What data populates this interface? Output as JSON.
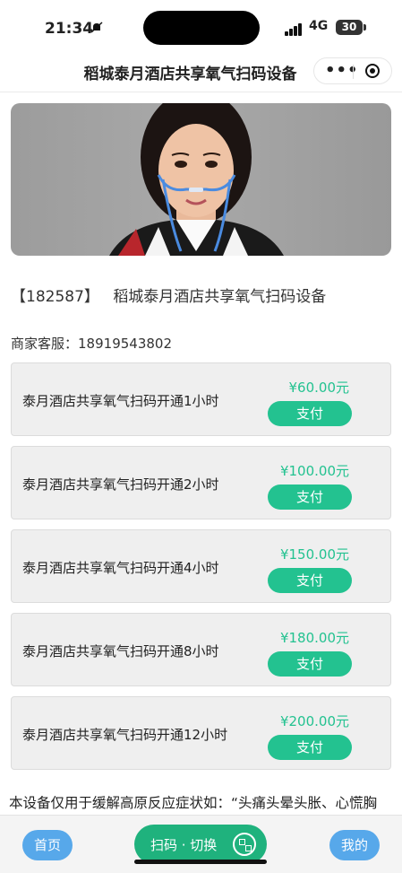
{
  "status_bar": {
    "time": "21:34",
    "network": "4G",
    "battery": "30"
  },
  "nav": {
    "title": "稻城泰月酒店共享氧气扫码设备"
  },
  "device": {
    "code": "【182587】",
    "name": "稻城泰月酒店共享氧气扫码设备"
  },
  "service": {
    "label": "商家客服：",
    "phone": "18919543802"
  },
  "plans": [
    {
      "label": "泰月酒店共享氧气扫码开通1小时",
      "price": "¥60.00元",
      "pay": "支付"
    },
    {
      "label": "泰月酒店共享氧气扫码开通2小时",
      "price": "¥100.00元",
      "pay": "支付"
    },
    {
      "label": "泰月酒店共享氧气扫码开通4小时",
      "price": "¥150.00元",
      "pay": "支付"
    },
    {
      "label": "泰月酒店共享氧气扫码开通8小时",
      "price": "¥180.00元",
      "pay": "支付"
    },
    {
      "label": "泰月酒店共享氧气扫码开通12小时",
      "price": "¥200.00元",
      "pay": "支付"
    }
  ],
  "description": "本设备仅用于缓解高原反应症状如：“头痛头晕头胀、心慌胸",
  "bottom": {
    "home": "首页",
    "scan": "扫码 · 切换",
    "mine": "我的"
  },
  "colors": {
    "accent": "#23c290",
    "button_blue": "#57a8ea",
    "scan_green": "#1fb27d"
  }
}
